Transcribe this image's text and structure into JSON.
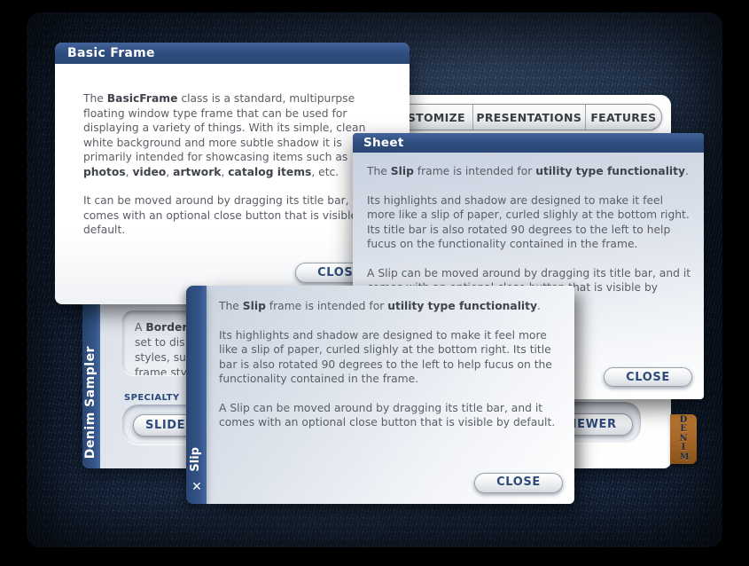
{
  "colors": {
    "titlebar_blue": "#2e4d7c",
    "denim_base": "#182a44",
    "tag_copper": "#a8682a",
    "button_text": "#2d4b7a",
    "body_text": "#5a5e66"
  },
  "basic_frame": {
    "title": "Basic Frame",
    "p1": [
      {
        "t": "The "
      },
      {
        "t": "BasicFrame",
        "b": true
      },
      {
        "t": " class is a standard, multipurpse floating window type frame that can be used for displaying a variety of things. With its simple, clean white background and more subtle shadow it is primarily intended for showcasing items such as "
      },
      {
        "t": "photos",
        "b": true
      },
      {
        "t": ", "
      },
      {
        "t": "video",
        "b": true
      },
      {
        "t": ", "
      },
      {
        "t": "artwork",
        "b": true
      },
      {
        "t": ", "
      },
      {
        "t": "catalog items",
        "b": true
      },
      {
        "t": ", etc."
      }
    ],
    "p2": [
      {
        "t": "It can be moved around by dragging its title bar, and comes with an optional close button that is visible by default."
      }
    ],
    "close_label": "CLOSE"
  },
  "sheet_window": {
    "title": "Sheet",
    "p1": [
      {
        "t": "The "
      },
      {
        "t": "Slip",
        "b": true
      },
      {
        "t": " frame is intended for "
      },
      {
        "t": "utility type functionality",
        "b": true
      },
      {
        "t": "."
      }
    ],
    "p2": "Its highlights and shadow are designed to make it feel more like a slip of paper, curled slighly at the bottom right. Its title bar is also rotated 90 degrees to the left to help fucus on the functionality contained in the frame.",
    "p3": "A Slip can be moved around by dragging its title bar, and it comes with an optional close button that is visible by default.",
    "close_label": "CLOSE"
  },
  "slip_window": {
    "title": "Slip",
    "close_icon": "✕",
    "p1": [
      {
        "t": "The "
      },
      {
        "t": "Slip",
        "b": true
      },
      {
        "t": " frame is intended for "
      },
      {
        "t": "utility type functionality",
        "b": true
      },
      {
        "t": "."
      }
    ],
    "p2": "Its highlights and shadow are designed to make it feel more like a slip of paper, curled slighly at the bottom right. Its title bar is also rotated 90 degrees to the left to help fucus on the functionality contained in the frame.",
    "p3": "A Slip can be moved around by dragging its title bar, and it comes with an optional close button that is visible by default.",
    "close_label": "CLOSE"
  },
  "main_window": {
    "title": "Denim Sampler",
    "tabs": [
      {
        "label": "CUSTOMIZE"
      },
      {
        "label": "PRESENTATIONS"
      },
      {
        "label": "FEATURES"
      }
    ],
    "border_box": {
      "line1": [
        {
          "t": "A "
        },
        {
          "t": "Border",
          "b": true
        }
      ],
      "line2": "set to dis",
      "line3": "styles, su",
      "line4": "frame sty"
    },
    "specialty_label": "SPECIALTY",
    "slideshow_button": "SLIDESHOW",
    "viewer_button": "VIEWER",
    "denim_tag": "DENIM"
  }
}
